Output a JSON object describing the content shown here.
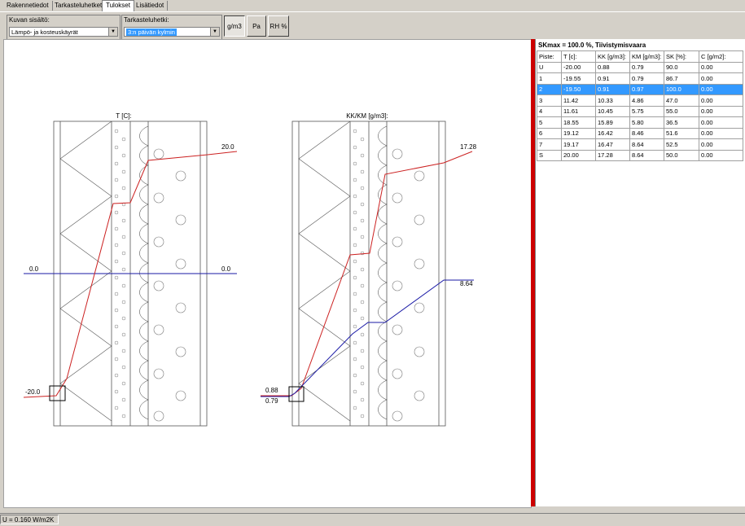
{
  "tabs": [
    "Rakennetiedot",
    "Tarkasteluhetket",
    "Tulokset",
    "Lisätiedot"
  ],
  "toolbar": {
    "content_label": "Kuvan sisältö:",
    "content_value": "Lämpö- ja kosteuskäyrät",
    "moment_label": "Tarkasteluhetki:",
    "moment_value": "3:n päivän kylmin",
    "btn_gm3": "g/m3",
    "btn_pa": "Pa",
    "btn_rh": "RH %"
  },
  "charts": {
    "left_title": "T [C]:",
    "right_title": "KK/KM [g/m3]:",
    "left_labels": {
      "top_right": "20.0",
      "left_mid": "0.0",
      "right_mid": "0.0",
      "bottom_left": "-20.0"
    },
    "right_labels": {
      "top_right": "17.28",
      "mid_right": "8.64",
      "bottom_kk": "0.88",
      "bottom_km": "0.79"
    }
  },
  "table": {
    "title": "SKmax = 100.0 %, Tiivistymisvaara",
    "headers": [
      "Piste:",
      "T [c]:",
      "KK [g/m3]:",
      "KM [g/m3]:",
      "SK [%]:",
      "C [g/m2]:"
    ],
    "rows": [
      [
        "U",
        "-20.00",
        "0.88",
        "0.79",
        "90.0",
        "0.00"
      ],
      [
        "1",
        "-19.55",
        "0.91",
        "0.79",
        "86.7",
        "0.00"
      ],
      [
        "2",
        "-19.50",
        "0.91",
        "0.97",
        "100.0",
        "0.00"
      ],
      [
        "3",
        "11.42",
        "10.33",
        "4.86",
        "47.0",
        "0.00"
      ],
      [
        "4",
        "11.61",
        "10.45",
        "5.75",
        "55.0",
        "0.00"
      ],
      [
        "5",
        "18.55",
        "15.89",
        "5.80",
        "36.5",
        "0.00"
      ],
      [
        "6",
        "19.12",
        "16.42",
        "8.46",
        "51.6",
        "0.00"
      ],
      [
        "7",
        "19.17",
        "16.47",
        "8.64",
        "52.5",
        "0.00"
      ],
      [
        "S",
        "20.00",
        "17.28",
        "8.64",
        "50.0",
        "0.00"
      ]
    ],
    "selected_row": 2
  },
  "status": {
    "u_value": "U = 0.160 W/m2K"
  },
  "colors": {
    "temperature": "#cc2222",
    "kk": "#cc2222",
    "km": "#1a1aa6",
    "selection": "#3399ff",
    "splitter": "#cc0000"
  }
}
